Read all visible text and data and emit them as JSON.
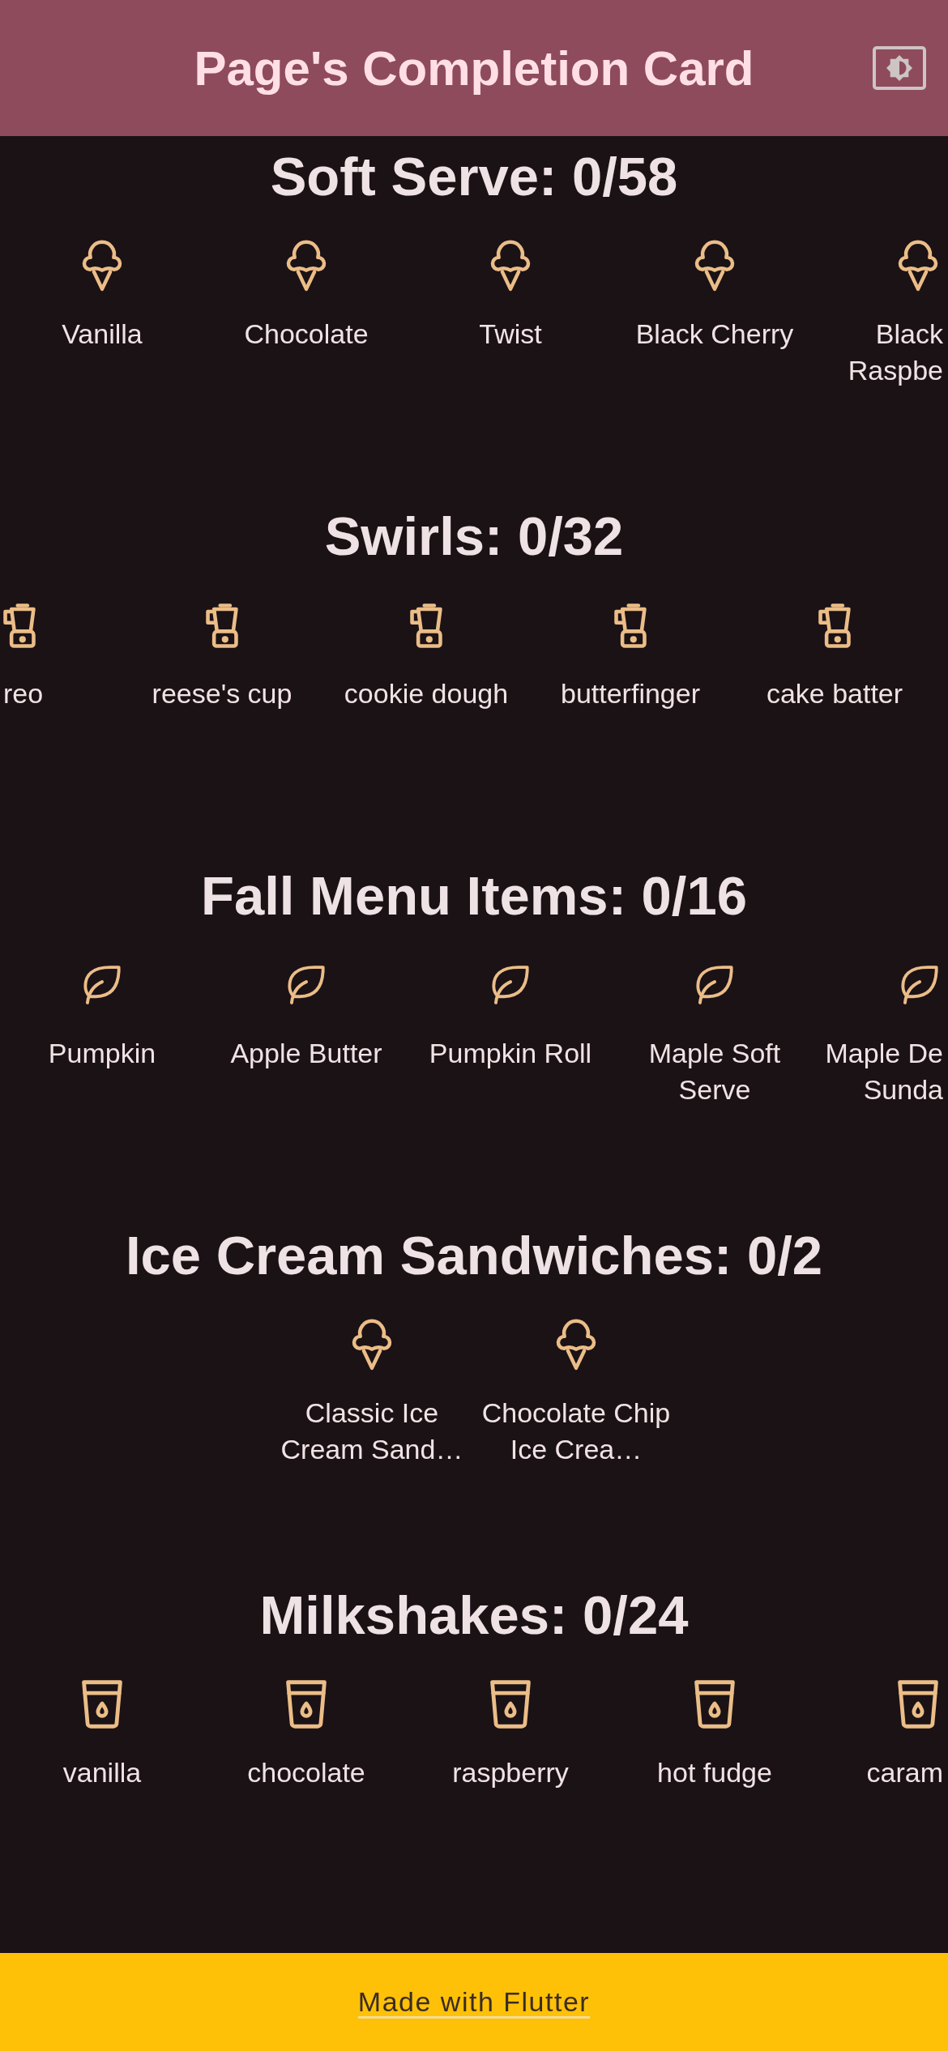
{
  "app_bar": {
    "title": "Page's Completion Card"
  },
  "sections": [
    {
      "kind": "soft_serve",
      "title": "Soft Serve: 0/58",
      "items": [
        {
          "label": "Vanilla",
          "clipped": false
        },
        {
          "label": "Chocolate",
          "clipped": false
        },
        {
          "label": "Twist",
          "clipped": false
        },
        {
          "label": "Black Cherry",
          "clipped": false
        },
        {
          "label": "Black Raspbe",
          "clipped": true
        }
      ]
    },
    {
      "kind": "swirl",
      "title": "Swirls: 0/32",
      "items": [
        {
          "label": "reo",
          "clipped": true
        },
        {
          "label": "reese's cup",
          "clipped": false
        },
        {
          "label": "cookie dough",
          "clipped": false
        },
        {
          "label": "butterfinger",
          "clipped": false
        },
        {
          "label": "cake batter",
          "clipped": false
        }
      ]
    },
    {
      "kind": "seasonal",
      "title": "Fall Menu Items: 0/16",
      "items": [
        {
          "label": "Pumpkin",
          "clipped": false
        },
        {
          "label": "Apple Butter",
          "clipped": false
        },
        {
          "label": "Pumpkin Roll",
          "clipped": false
        },
        {
          "label": "Maple Soft Serve",
          "clipped": false
        },
        {
          "label": "Maple De Sunda",
          "clipped": true
        }
      ]
    },
    {
      "kind": "sandwich",
      "title": "Ice Cream Sandwiches: 0/2",
      "items": [
        {
          "label": "Classic Ice Cream Sand…",
          "clipped": false
        },
        {
          "label": "Chocolate Chip Ice Crea…",
          "clipped": false
        }
      ]
    },
    {
      "kind": "shake",
      "title": "Milkshakes: 0/24",
      "items": [
        {
          "label": "vanilla",
          "clipped": false
        },
        {
          "label": "chocolate",
          "clipped": false
        },
        {
          "label": "raspberry",
          "clipped": false
        },
        {
          "label": "hot fudge",
          "clipped": false
        },
        {
          "label": "caram",
          "clipped": true
        }
      ]
    }
  ],
  "footer": {
    "link": "Made with Flutter"
  }
}
